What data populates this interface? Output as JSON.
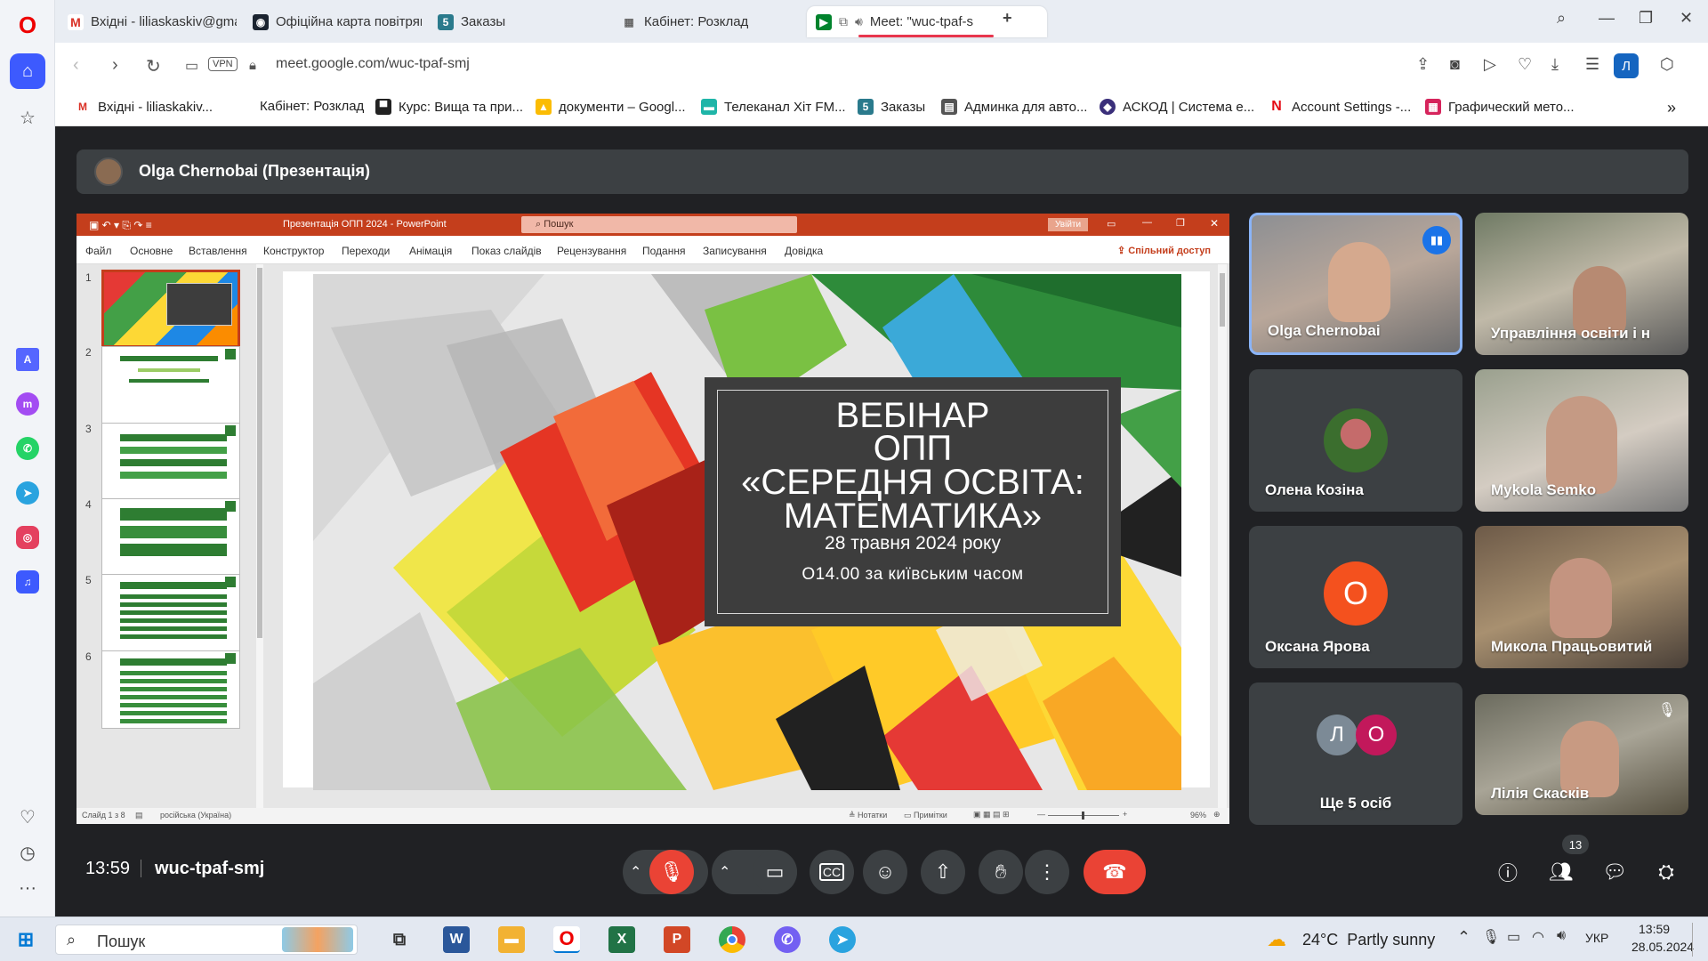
{
  "browser": {
    "tabs": [
      {
        "icon": "gmail-icon",
        "label": "Вхідні - liliaskaskiv@gmai"
      },
      {
        "icon": "air-alert-icon",
        "label": "Офіційна карта повітряна"
      },
      {
        "icon": "five-icon",
        "label": "Заказы"
      },
      {
        "icon": "cabinet-icon",
        "label": "Кабінет: Розклад"
      },
      {
        "icon": "meet-icon",
        "label": "Meet: \"wuc-tpaf-s"
      }
    ],
    "url": "meet.google.com/wuc-tpaf-smj",
    "vpn_label": "VPN",
    "profile_letter": "Л",
    "bookmarks": [
      "Вхідні - liliaskakiv...",
      "Кабінет: Розклад",
      "Курс: Вища та при...",
      "документи – Googl...",
      "Телеканал Хіт FM...",
      "Заказы",
      "Админка для авто...",
      "АСКОД | Система е...",
      "Account Settings -...",
      "Графический мето..."
    ]
  },
  "meet": {
    "presenter_banner": "Olga Chernobai (Презентація)",
    "clock": "13:59",
    "meeting_code": "wuc-tpaf-smj",
    "participants_count": "13",
    "participants": [
      {
        "name": "Olga Chernobai",
        "type": "video",
        "speaking": true
      },
      {
        "name": "Управління освіти і н",
        "type": "video"
      },
      {
        "name": "Олена Козіна",
        "type": "avatar-photo"
      },
      {
        "name": "Mykola Semko",
        "type": "video"
      },
      {
        "name": "Оксана Ярова",
        "type": "letter",
        "letter": "О",
        "color": "#f4511e"
      },
      {
        "name": "Микола Працьовитий",
        "type": "video"
      },
      {
        "name": "Ще 5 осіб",
        "type": "more",
        "letters": [
          "Л",
          "О"
        ]
      },
      {
        "name": "Лілія Скасків",
        "type": "video",
        "muted": true
      }
    ]
  },
  "ppt": {
    "title": "Презентація ОПП 2024 - PowerPoint",
    "search_placeholder": "Пошук",
    "signin": "Увійти",
    "share": "Спільний доступ",
    "ribbon": [
      "Файл",
      "Основне",
      "Вставлення",
      "Конструктор",
      "Переходи",
      "Анімація",
      "Показ слайдів",
      "Рецензування",
      "Подання",
      "Записування",
      "Довідка"
    ],
    "thumb_numbers": [
      "1",
      "2",
      "3",
      "4",
      "5",
      "6"
    ],
    "status_left": "Слайд 1 з 8",
    "status_lang": "російська (Україна)",
    "status_notes": "Нотатки",
    "status_comments": "Примітки",
    "zoom": "96%",
    "slide": {
      "line1": "ВЕБІНАР",
      "line2": "ОПП",
      "line3": "«СЕРЕДНЯ ОСВІТА:",
      "line4": "МАТЕМАТИКА»",
      "date": "28 травня 2024 року",
      "time": "О14.00 за київським часом"
    }
  },
  "taskbar": {
    "search": "Пошук",
    "weather": "24°C  Partly sunny",
    "lang": "УКР",
    "time": "13:59",
    "date": "28.05.2024"
  },
  "colors": {
    "accent": "#1a73e8",
    "end_call": "#ea4335",
    "ppt_red": "#c43e1c"
  }
}
